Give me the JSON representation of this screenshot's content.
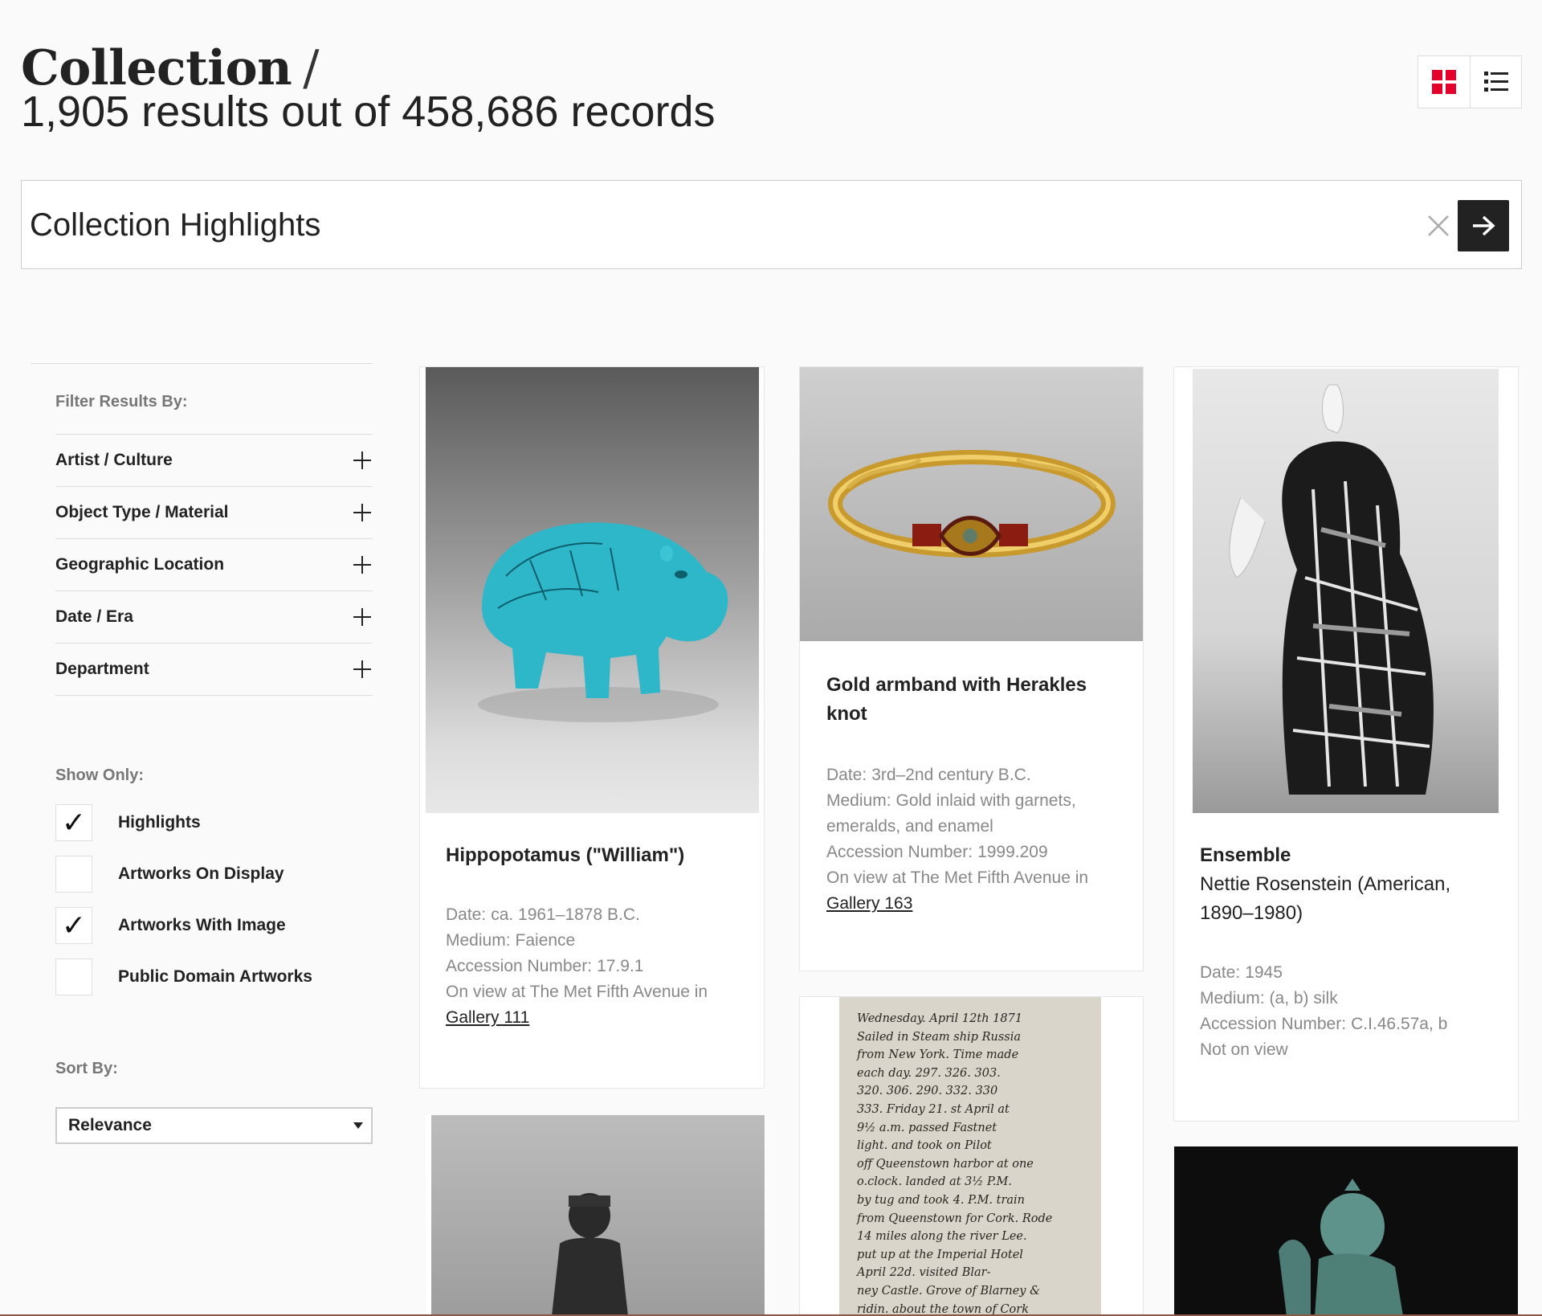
{
  "header": {
    "title": "Collection",
    "separator": "/",
    "result_count": "1,905 results out of 458,686 records"
  },
  "view_toggle": {
    "grid_icon": "grid-icon",
    "list_icon": "list-icon",
    "active": "grid",
    "active_color": "#e4002b"
  },
  "search": {
    "value": "Collection Highlights",
    "clear_icon": "close-icon",
    "submit_icon": "arrow-right-icon"
  },
  "filters": {
    "heading": "Filter Results By:",
    "items": [
      {
        "label": "Artist / Culture"
      },
      {
        "label": "Object Type / Material"
      },
      {
        "label": "Geographic Location"
      },
      {
        "label": "Date / Era"
      },
      {
        "label": "Department"
      }
    ]
  },
  "show_only": {
    "heading": "Show Only:",
    "options": [
      {
        "label": "Highlights",
        "checked": true,
        "mark": "✓"
      },
      {
        "label": "Artworks On Display",
        "checked": false,
        "mark": ""
      },
      {
        "label": "Artworks With Image",
        "checked": true,
        "mark": "✓"
      },
      {
        "label": "Public Domain Artworks",
        "checked": false,
        "mark": ""
      }
    ]
  },
  "sort": {
    "heading": "Sort By:",
    "value": "Relevance"
  },
  "results": [
    {
      "title": "Hippopotamus (\"William\")",
      "date_label": "Date:",
      "date": "ca. 1961–1878 B.C.",
      "medium_label": "Medium:",
      "medium": "Faience",
      "accession_label": "Accession Number:",
      "accession": "17.9.1",
      "on_view": "On view at The Met Fifth Avenue in",
      "gallery": "Gallery 111"
    },
    {
      "title": "Gold armband with Herakles knot",
      "date_label": "Date:",
      "date": "3rd–2nd century B.C.",
      "medium_label": "Medium:",
      "medium": "Gold inlaid with garnets, emeralds, and enamel",
      "accession_label": "Accession Number:",
      "accession": "1999.209",
      "on_view": "On view at The Met Fifth Avenue in",
      "gallery": "Gallery 163"
    },
    {
      "title": "Ensemble",
      "artist": "Nettie Rosenstein (American, 1890–1980)",
      "date_label": "Date:",
      "date": "1945",
      "medium_label": "Medium:",
      "medium": "(a, b) silk",
      "accession_label": "Accession Number:",
      "accession": "C.I.46.57a, b",
      "on_view": "Not on view"
    }
  ],
  "manuscript_lines": [
    "Wednesday. April 12th 1871",
    "Sailed in Steam ship Russia",
    "from New York. Time made",
    "each day. 297. 326. 303.",
    "320. 306. 290. 332. 330",
    "333. Friday 21. st April at",
    "9½ a.m. passed Fastnet",
    "light. and took on Pilot",
    "off Queenstown harbor at one",
    "o.clock. landed at 3½ P.M.",
    "by tug and took 4. P.M. train",
    "from Queenstown for Cork. Rode",
    "14 miles along the river Lee.",
    "put up at the Imperial Hotel",
    "April 22d. visited Blar-",
    "ney Castle. Grove of Blarney &",
    "ridin. about the town of Cork"
  ]
}
